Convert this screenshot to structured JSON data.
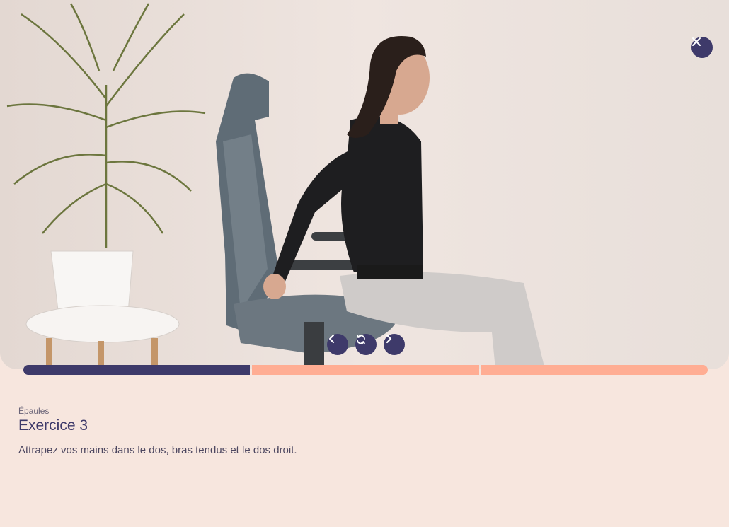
{
  "media": {
    "image_alt": "exercise-illustration"
  },
  "controls": {
    "close_icon": "close-icon",
    "prev_icon": "chevron-left-icon",
    "replay_icon": "replay-icon",
    "next_icon": "chevron-right-icon"
  },
  "progress": {
    "segments_total": 3,
    "segments_done": 1,
    "colors": {
      "done": "#3e3a6a",
      "todo": "#ffad93"
    }
  },
  "exercise": {
    "category": "Épaules",
    "title": "Exercice 3",
    "description": "Attrapez vos mains dans le dos, bras tendus et le dos droit."
  },
  "colors": {
    "accent": "#3e3a6a",
    "background": "#f7e6de"
  }
}
